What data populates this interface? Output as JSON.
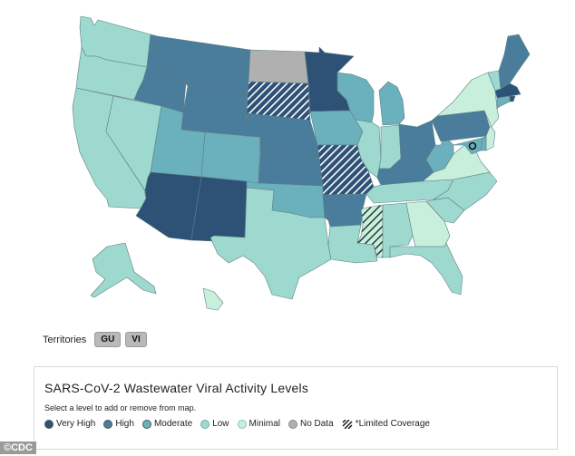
{
  "map": {
    "title": "SARS-CoV-2 Wastewater Viral Activity Levels map",
    "colors": {
      "very_high": "#2e5176",
      "high": "#4a7d9b",
      "moderate": "#6ab0bd",
      "low": "#9ed9cf",
      "minimal": "#c8efdc",
      "no_data": "#b0b0b0",
      "limited_coverage_stripe": "#ffffff"
    },
    "states": [
      {
        "id": "WA",
        "name": "Washington",
        "level": "low"
      },
      {
        "id": "OR",
        "name": "Oregon",
        "level": "low"
      },
      {
        "id": "CA",
        "name": "California",
        "level": "low"
      },
      {
        "id": "NV",
        "name": "Nevada",
        "level": "low"
      },
      {
        "id": "ID",
        "name": "Idaho",
        "level": "high"
      },
      {
        "id": "MT",
        "name": "Montana",
        "level": "high"
      },
      {
        "id": "WY",
        "name": "Wyoming",
        "level": "high"
      },
      {
        "id": "UT",
        "name": "Utah",
        "level": "moderate"
      },
      {
        "id": "CO",
        "name": "Colorado",
        "level": "moderate"
      },
      {
        "id": "AZ",
        "name": "Arizona",
        "level": "very_high"
      },
      {
        "id": "NM",
        "name": "New Mexico",
        "level": "very_high"
      },
      {
        "id": "ND",
        "name": "North Dakota",
        "level": "no_data"
      },
      {
        "id": "SD",
        "name": "South Dakota",
        "level": "very_high",
        "limited": true
      },
      {
        "id": "NE",
        "name": "Nebraska",
        "level": "high"
      },
      {
        "id": "KS",
        "name": "Kansas",
        "level": "high"
      },
      {
        "id": "OK",
        "name": "Oklahoma",
        "level": "moderate"
      },
      {
        "id": "TX",
        "name": "Texas",
        "level": "low"
      },
      {
        "id": "MN",
        "name": "Minnesota",
        "level": "very_high"
      },
      {
        "id": "IA",
        "name": "Iowa",
        "level": "moderate"
      },
      {
        "id": "MO",
        "name": "Missouri",
        "level": "very_high",
        "limited": true
      },
      {
        "id": "AR",
        "name": "Arkansas",
        "level": "high"
      },
      {
        "id": "LA",
        "name": "Louisiana",
        "level": "low"
      },
      {
        "id": "WI",
        "name": "Wisconsin",
        "level": "moderate"
      },
      {
        "id": "IL",
        "name": "Illinois",
        "level": "low"
      },
      {
        "id": "MI",
        "name": "Michigan",
        "level": "moderate"
      },
      {
        "id": "IN",
        "name": "Indiana",
        "level": "low"
      },
      {
        "id": "OH",
        "name": "Ohio",
        "level": "high"
      },
      {
        "id": "KY",
        "name": "Kentucky",
        "level": "high"
      },
      {
        "id": "TN",
        "name": "Tennessee",
        "level": "low"
      },
      {
        "id": "MS",
        "name": "Mississippi",
        "level": "minimal",
        "limited": true
      },
      {
        "id": "AL",
        "name": "Alabama",
        "level": "low"
      },
      {
        "id": "GA",
        "name": "Georgia",
        "level": "minimal"
      },
      {
        "id": "FL",
        "name": "Florida",
        "level": "low"
      },
      {
        "id": "SC",
        "name": "South Carolina",
        "level": "low"
      },
      {
        "id": "NC",
        "name": "North Carolina",
        "level": "low"
      },
      {
        "id": "VA",
        "name": "Virginia",
        "level": "minimal"
      },
      {
        "id": "WV",
        "name": "West Virginia",
        "level": "moderate"
      },
      {
        "id": "PA",
        "name": "Pennsylvania",
        "level": "high"
      },
      {
        "id": "NY",
        "name": "New York",
        "level": "minimal"
      },
      {
        "id": "VT",
        "name": "Vermont",
        "level": "low"
      },
      {
        "id": "NH",
        "name": "New Hampshire",
        "level": "high"
      },
      {
        "id": "ME",
        "name": "Maine",
        "level": "high"
      },
      {
        "id": "MA",
        "name": "Massachusetts",
        "level": "very_high"
      },
      {
        "id": "RI",
        "name": "Rhode Island",
        "level": "very_high"
      },
      {
        "id": "CT",
        "name": "Connecticut",
        "level": "moderate"
      },
      {
        "id": "NJ",
        "name": "New Jersey",
        "level": "minimal"
      },
      {
        "id": "DE",
        "name": "Delaware",
        "level": "moderate"
      },
      {
        "id": "MD",
        "name": "Maryland",
        "level": "moderate"
      },
      {
        "id": "DC",
        "name": "District of Columbia",
        "level": "moderate"
      },
      {
        "id": "AK",
        "name": "Alaska",
        "level": "low"
      },
      {
        "id": "HI",
        "name": "Hawaii",
        "level": "minimal"
      }
    ]
  },
  "territories": {
    "label": "Territories",
    "buttons": [
      "GU",
      "VI"
    ]
  },
  "legend": {
    "title": "SARS-CoV-2 Wastewater Viral Activity Levels",
    "subtitle": "Select a level to add or remove from map.",
    "items": [
      {
        "key": "very_high",
        "label": "Very High",
        "color": "#2e5176"
      },
      {
        "key": "high",
        "label": "High",
        "color": "#4a7d9b"
      },
      {
        "key": "moderate",
        "label": "Moderate",
        "color": "#6ab0bd"
      },
      {
        "key": "low",
        "label": "Low",
        "color": "#9ed9cf"
      },
      {
        "key": "minimal",
        "label": "Minimal",
        "color": "#c8efdc"
      },
      {
        "key": "no_data",
        "label": "No Data",
        "color": "#b0b0b0"
      },
      {
        "key": "limited",
        "label": "*Limited Coverage",
        "color": "hatch"
      }
    ]
  },
  "credit": "©CDC"
}
